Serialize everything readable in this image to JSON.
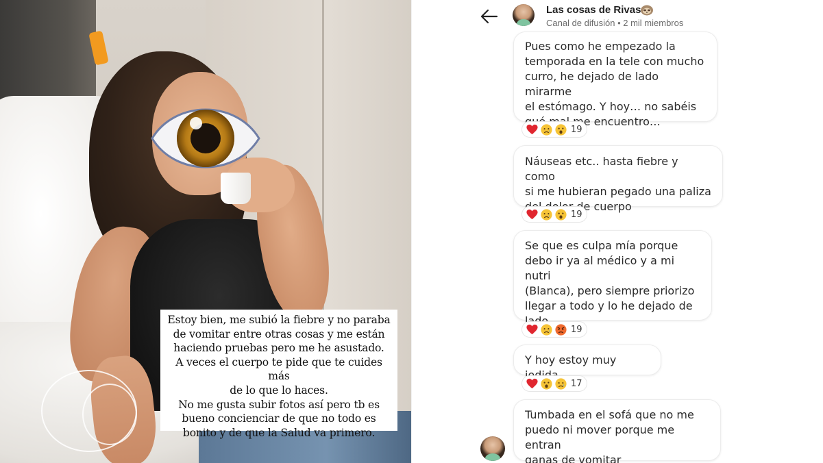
{
  "story": {
    "caption_lines": [
      "Estoy bien, me subió la fiebre y no paraba",
      "de vomitar entre otras cosas y me están",
      "haciendo pruebas pero me he asustado.",
      "A veces el cuerpo te pide que te cuides más",
      "de lo que lo haces.",
      "No me gusta subir fotos así pero tb es",
      "bueno concienciar de que no todo es",
      "bonito y de que la Salud va primero."
    ],
    "cover_icon": "eye-emoji"
  },
  "channel": {
    "name": "Las cosas de Rivas",
    "name_emoji": "sloth-emoji",
    "subtitle": "Canal de difusión • 2 mil miembros",
    "back_icon": "arrow-left-icon"
  },
  "messages": [
    {
      "lines": [
        "Pues como he empezado la",
        "temporada en la tele con mucho",
        "curro, he dejado de lado mirarme",
        "el estómago. Y hoy… no sabéis",
        "qué mal me encuentro…"
      ],
      "reactions": [
        "red-heart",
        "sad-tear-face",
        "astonished-face"
      ],
      "count": "19"
    },
    {
      "lines": [
        "Náuseas etc.. hasta fiebre y como",
        "si me hubieran pegado una paliza",
        "del dolor de cuerpo"
      ],
      "reactions": [
        "red-heart",
        "sad-tear-face",
        "astonished-face"
      ],
      "count": "19"
    },
    {
      "lines": [
        "Se que es culpa mía porque",
        "debo ir ya al médico y a mi nutri",
        "(Blanca), pero siempre priorizo",
        "llegar a todo y lo he dejado de",
        "lado"
      ],
      "reactions": [
        "red-heart",
        "sad-tear-face",
        "angry-face"
      ],
      "count": "19"
    },
    {
      "lines": [
        "Y hoy estoy muy jodida"
      ],
      "reactions": [
        "red-heart",
        "astonished-face",
        "sad-tear-face"
      ],
      "count": "17"
    },
    {
      "lines": [
        "Tumbada en el sofá que no me",
        "puedo ni mover porque me entran",
        "ganas de vomitar"
      ],
      "reactions": [],
      "count": ""
    }
  ],
  "colors": {
    "heart": "#e0262f",
    "emoji_face": "#f6c437",
    "angry_face": "#ef6a2e",
    "caption_bg": "#ffffff",
    "bubble_border": "#ececec"
  }
}
